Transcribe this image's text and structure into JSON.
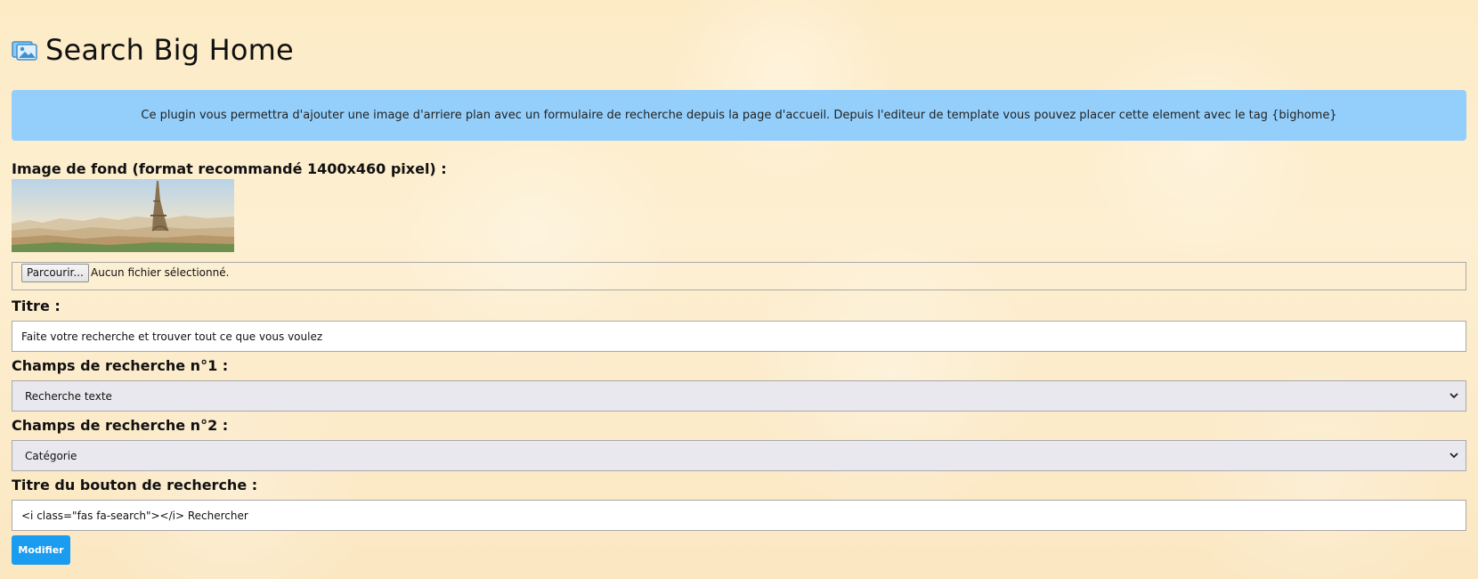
{
  "header": {
    "title": "Search Big Home",
    "icon": "images-icon"
  },
  "info": {
    "text": "Ce plugin vous permettra d'ajouter une image d'arriere plan avec un formulaire de recherche depuis la page d'accueil. Depuis l'editeur de template vous pouvez placer cette element avec le tag {bighome}"
  },
  "form": {
    "image_label": "Image de fond (format recommandé 1400x460 pixel) :",
    "file_button": "Parcourir...",
    "file_status": "Aucun fichier sélectionné.",
    "title_label": "Titre :",
    "title_value": "Faite votre recherche et trouver tout ce que vous voulez",
    "field1_label": "Champs de recherche n°1 :",
    "field1_value": "Recherche texte",
    "field2_label": "Champs de recherche n°2 :",
    "field2_value": "Catégorie",
    "button_title_label": "Titre du bouton de recherche :",
    "button_title_value": "<i class=\"fas fa-search\"></i> Rechercher",
    "submit_label": "Modifier"
  },
  "colors": {
    "info_bg": "#94cffb",
    "submit_bg": "#1a9cf0",
    "page_bg": "#fdebc6"
  }
}
